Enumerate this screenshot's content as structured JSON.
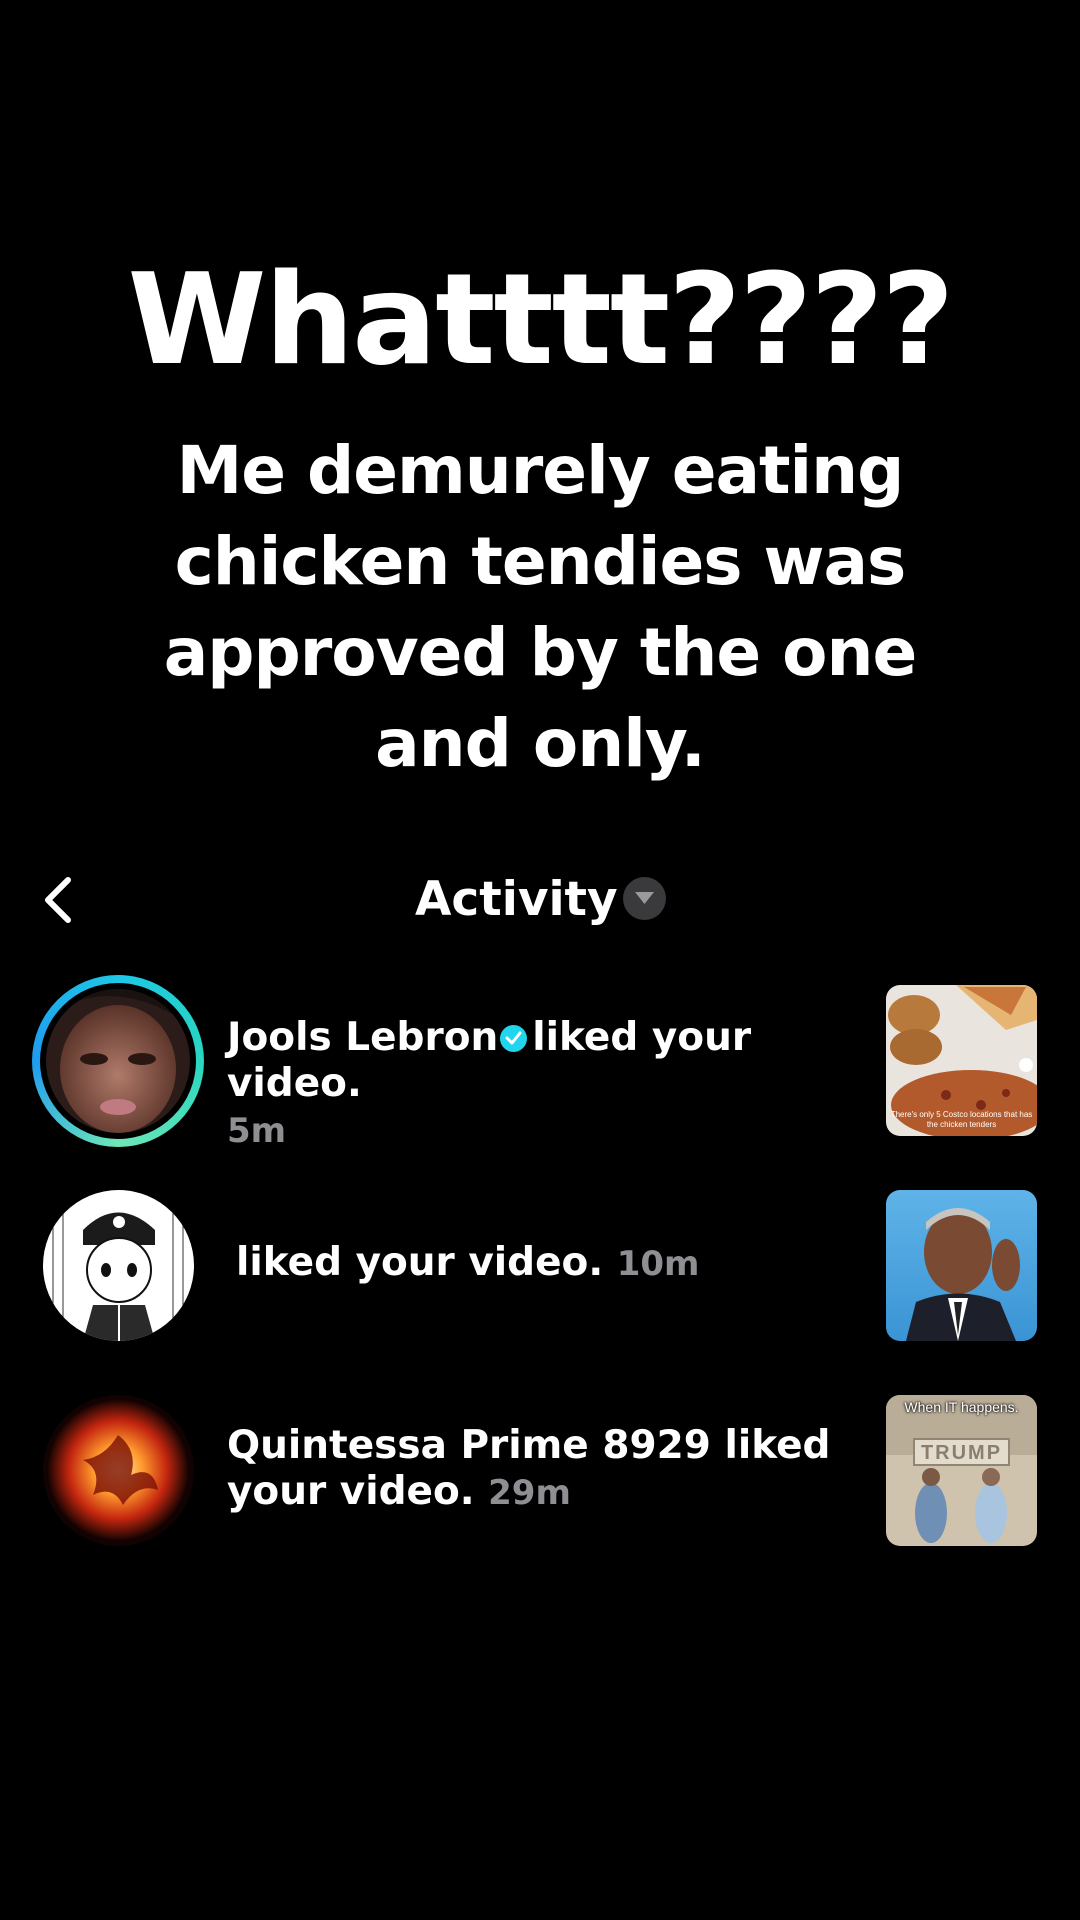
{
  "overlay": {
    "title": "Whatttt????",
    "caption": "Me demurely eating chicken tendies was approved by the one and only."
  },
  "header": {
    "title": "Activity",
    "back_icon": "chevron-left-icon",
    "dropdown_icon": "caret-down-icon"
  },
  "notifications": [
    {
      "user": "Jools Lebron",
      "verified": true,
      "action": "liked your video.",
      "time": "5m",
      "thumb_caption": "There's only 5 Costco locations that has the chicken tenders"
    },
    {
      "user": "",
      "verified": false,
      "action": "liked your video.",
      "time": "10m"
    },
    {
      "user": "Quintessa Prime 8929",
      "verified": false,
      "action_line1": "liked",
      "action_line2": "your video.",
      "time": "29m",
      "thumb_caption": "When IT happens.",
      "thumb_sign": "TRUMP"
    }
  ],
  "colors": {
    "background": "#000000",
    "text": "#ffffff",
    "muted": "#8e8e93",
    "verified": "#20d5ec",
    "story_ring": "#1ec7e6"
  }
}
